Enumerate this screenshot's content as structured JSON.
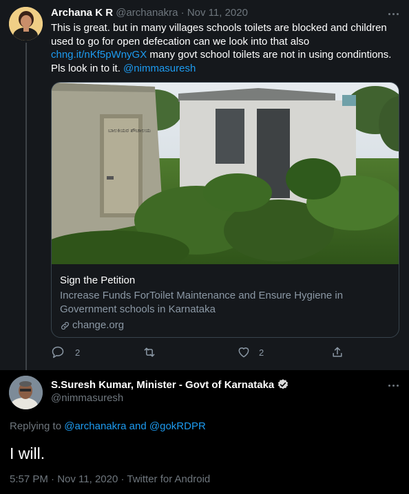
{
  "tweet1": {
    "author_name": "Archana K R",
    "handle": "@archanakra",
    "separator": "·",
    "date": "Nov 11, 2020",
    "text_part1": "This is great. but in many villages schools toilets are blocked and children used to go for open defecation can we look into that also ",
    "link": "chng.it/nKf5pWnyGX",
    "text_part2": "  many govt school toilets are not in using condintions. Pls look in to it. ",
    "mention": "@nimmasuresh",
    "card": {
      "sign_text": "ಬಾಲಕಿಯರ ಶೌಚಾಲಯ",
      "title": "Sign the Petition",
      "description": "Increase Funds ForToilet Maintenance and Ensure Hygiene in Government schools in Karnataka",
      "domain": "change.org"
    },
    "replies": "2",
    "likes": "2"
  },
  "tweet2": {
    "author_name": "S.Suresh Kumar, Minister - Govt of Karnataka",
    "handle": "@nimmasuresh",
    "replying_prefix": "Replying to ",
    "replying_user1": "@archanakra",
    "replying_and": " and ",
    "replying_user2": "@gokRDPR",
    "text": "I will.",
    "meta": "5:57 PM · Nov 11, 2020 · Twitter for Android"
  },
  "colors": {
    "link": "#1d9bf0",
    "muted": "#6e767d",
    "background_top": "#15181c",
    "background_bottom": "#000000"
  }
}
